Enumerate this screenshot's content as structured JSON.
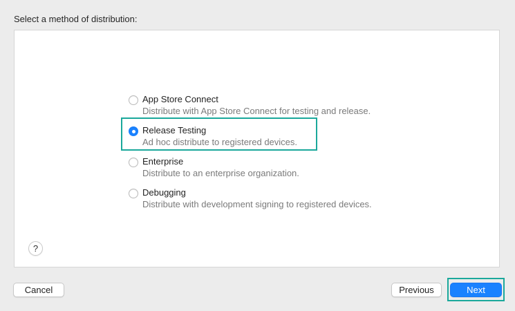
{
  "dialog": {
    "heading": "Select a method of distribution:"
  },
  "options": [
    {
      "title": "App Store Connect",
      "description": "Distribute with App Store Connect for testing and release.",
      "selected": false
    },
    {
      "title": "Release Testing",
      "description": "Ad hoc distribute to registered devices.",
      "selected": true
    },
    {
      "title": "Enterprise",
      "description": "Distribute to an enterprise organization.",
      "selected": false
    },
    {
      "title": "Debugging",
      "description": "Distribute with development signing to registered devices.",
      "selected": false
    }
  ],
  "help": {
    "label": "?"
  },
  "buttons": {
    "cancel": "Cancel",
    "previous": "Previous",
    "next": "Next"
  },
  "colors": {
    "accent": "#1a82ff",
    "highlight": "#1aa89b"
  }
}
